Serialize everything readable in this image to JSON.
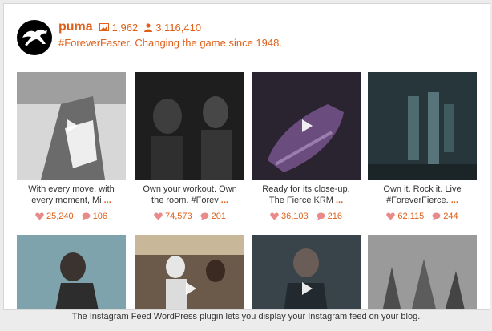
{
  "profile": {
    "username": "puma",
    "media_count": "1,962",
    "followers": "3,116,410",
    "bio": "#ForeverFaster. Changing the game since 1948."
  },
  "posts": [
    {
      "caption_line1": "With every move, with",
      "caption_line2": "every moment, Mi",
      "more": "...",
      "likes": "25,240",
      "comments": "106",
      "bg": "#c9c9c9",
      "video": true
    },
    {
      "caption_line1": "Own your workout. Own",
      "caption_line2": "the room. #Forev",
      "more": "...",
      "likes": "74,573",
      "comments": "201",
      "bg": "#2b2b2b",
      "video": false
    },
    {
      "caption_line1": "Ready for its close-up.",
      "caption_line2": "The Fierce KRM",
      "more": "...",
      "likes": "36,103",
      "comments": "216",
      "bg": "#4a3a57",
      "video": true
    },
    {
      "caption_line1": "Own it. Rock it. Live",
      "caption_line2": "#ForeverFierce.",
      "more": "...",
      "likes": "62,115",
      "comments": "244",
      "bg": "#3c4a4e",
      "video": false
    },
    {
      "bg": "#5e8a96",
      "video": false
    },
    {
      "bg": "#7d6a57",
      "video": true
    },
    {
      "bg": "#4d5861",
      "video": true
    },
    {
      "bg": "#8b8b8b",
      "video": false
    }
  ],
  "footer": {
    "text": "The Instagram Feed WordPress plugin lets you display your Instagram feed on your blog."
  }
}
